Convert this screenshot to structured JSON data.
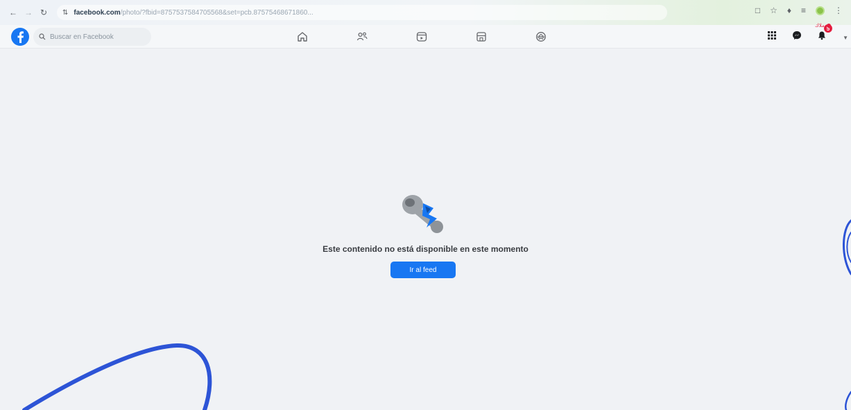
{
  "browser": {
    "url_domain": "facebook.com",
    "url_path": "/photo/?fbid=8757537584705568&set=pcb.87575468671860..."
  },
  "facebook": {
    "search_placeholder": "Buscar en Facebook",
    "notifications_count": "5",
    "annotation_text": "ملاك"
  },
  "main": {
    "message": "Este contenido no está disponible en este momento",
    "feed_button_label": "Ir al feed"
  },
  "icons": {
    "back": "arrow-left-icon",
    "forward": "arrow-right-icon",
    "reload": "reload-icon",
    "site_info": "tune-icon",
    "home": "home-icon",
    "friends": "friends-icon",
    "video": "video-icon",
    "marketplace": "marketplace-icon",
    "groups": "groups-icon",
    "menu": "grid-menu-icon",
    "messenger": "messenger-icon",
    "bell": "bell-icon"
  },
  "colors": {
    "brand": "#1877f2",
    "badge": "#e41e3f",
    "scribble": "#2d54d6"
  }
}
